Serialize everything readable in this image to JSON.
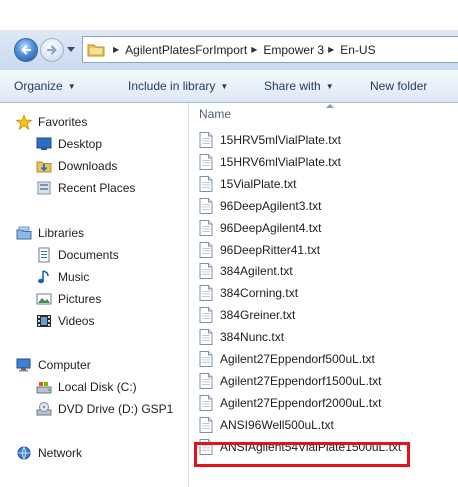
{
  "address_bar": {
    "crumbs": [
      "AgilentPlatesForImport",
      "Empower 3",
      "En-US"
    ]
  },
  "toolbar": {
    "organize": "Organize",
    "include_in_library": "Include in library",
    "share_with": "Share with",
    "new_folder": "New folder"
  },
  "nav": {
    "favorites": "Favorites",
    "desktop": "Desktop",
    "downloads": "Downloads",
    "recent_places": "Recent Places",
    "libraries": "Libraries",
    "documents": "Documents",
    "music": "Music",
    "pictures": "Pictures",
    "videos": "Videos",
    "computer": "Computer",
    "local_disk": "Local Disk (C:)",
    "dvd_drive": "DVD Drive (D:) GSP1",
    "network": "Network"
  },
  "list": {
    "column_name": "Name",
    "files": [
      "15HRV5mlVialPlate.txt",
      "15HRV6mlVialPlate.txt",
      "15VialPlate.txt",
      "96DeepAgilent3.txt",
      "96DeepAgilent4.txt",
      "96DeepRitter41.txt",
      "384Agilent.txt",
      "384Corning.txt",
      "384Greiner.txt",
      "384Nunc.txt",
      "Agilent27Eppendorf500uL.txt",
      "Agilent27Eppendorf1500uL.txt",
      "Agilent27Eppendorf2000uL.txt",
      "ANSI96Well500uL.txt",
      "ANSIAgilent54VialPlate1500uL.txt"
    ],
    "highlighted_file": "ANSIAgilent54VialPlate1500uL.txt",
    "highlight_color": "#e3121b"
  },
  "icons": {
    "back": "back-arrow-icon",
    "forward": "forward-arrow-icon",
    "file": "text-file-icon"
  }
}
